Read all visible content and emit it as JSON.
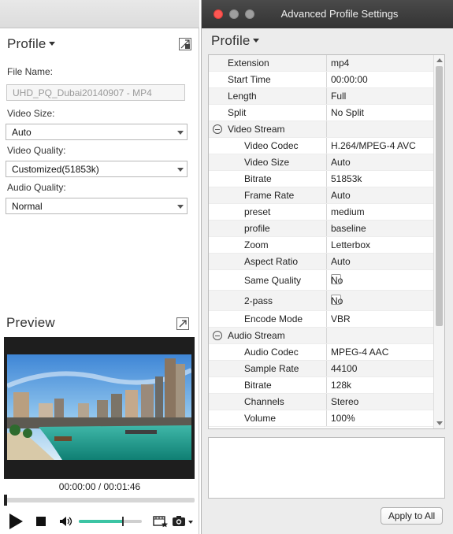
{
  "left": {
    "profile_title": "Profile",
    "file_name_label": "File Name:",
    "file_name_value": "UHD_PQ_Dubai20140907 - MP4",
    "video_size_label": "Video Size:",
    "video_size_value": "Auto",
    "video_quality_label": "Video Quality:",
    "video_quality_value": "Customized(51853k)",
    "audio_quality_label": "Audio Quality:",
    "audio_quality_value": "Normal",
    "preview_title": "Preview",
    "timecode": "00:00:00 / 00:01:46",
    "volume_level": 0.7
  },
  "window": {
    "title": "Advanced Profile Settings",
    "profile_title": "Profile",
    "apply_label": "Apply to All",
    "colors": {
      "close": "#fc5753",
      "minimize": "#a0a0a0",
      "zoom": "#a0a0a0",
      "titlebar": "#3a3a3a"
    },
    "rows": [
      {
        "key": "Extension",
        "value": "mp4",
        "level": 1
      },
      {
        "key": "Start Time",
        "value": "00:00:00",
        "level": 1
      },
      {
        "key": "Length",
        "value": "Full",
        "level": 1
      },
      {
        "key": "Split",
        "value": "No Split",
        "level": 1
      },
      {
        "key": "Video Stream",
        "value": "",
        "level": 0,
        "group": true
      },
      {
        "key": "Video Codec",
        "value": "H.264/MPEG-4 AVC",
        "level": 2
      },
      {
        "key": "Video Size",
        "value": "Auto",
        "level": 2
      },
      {
        "key": "Bitrate",
        "value": "51853k",
        "level": 2
      },
      {
        "key": "Frame Rate",
        "value": "Auto",
        "level": 2
      },
      {
        "key": "preset",
        "value": "medium",
        "level": 2
      },
      {
        "key": "profile",
        "value": "baseline",
        "level": 2
      },
      {
        "key": "Zoom",
        "value": "Letterbox",
        "level": 2
      },
      {
        "key": "Aspect Ratio",
        "value": "Auto",
        "level": 2
      },
      {
        "key": "Same Quality",
        "value": "No",
        "level": 2,
        "checkbox": true
      },
      {
        "key": "2-pass",
        "value": "No",
        "level": 2,
        "checkbox": true
      },
      {
        "key": "Encode Mode",
        "value": "VBR",
        "level": 2
      },
      {
        "key": "Audio Stream",
        "value": "",
        "level": 0,
        "group": true
      },
      {
        "key": "Audio Codec",
        "value": "MPEG-4 AAC",
        "level": 2
      },
      {
        "key": "Sample Rate",
        "value": "44100",
        "level": 2
      },
      {
        "key": "Bitrate",
        "value": "128k",
        "level": 2
      },
      {
        "key": "Channels",
        "value": "Stereo",
        "level": 2
      },
      {
        "key": "Volume",
        "value": "100%",
        "level": 2
      }
    ]
  }
}
